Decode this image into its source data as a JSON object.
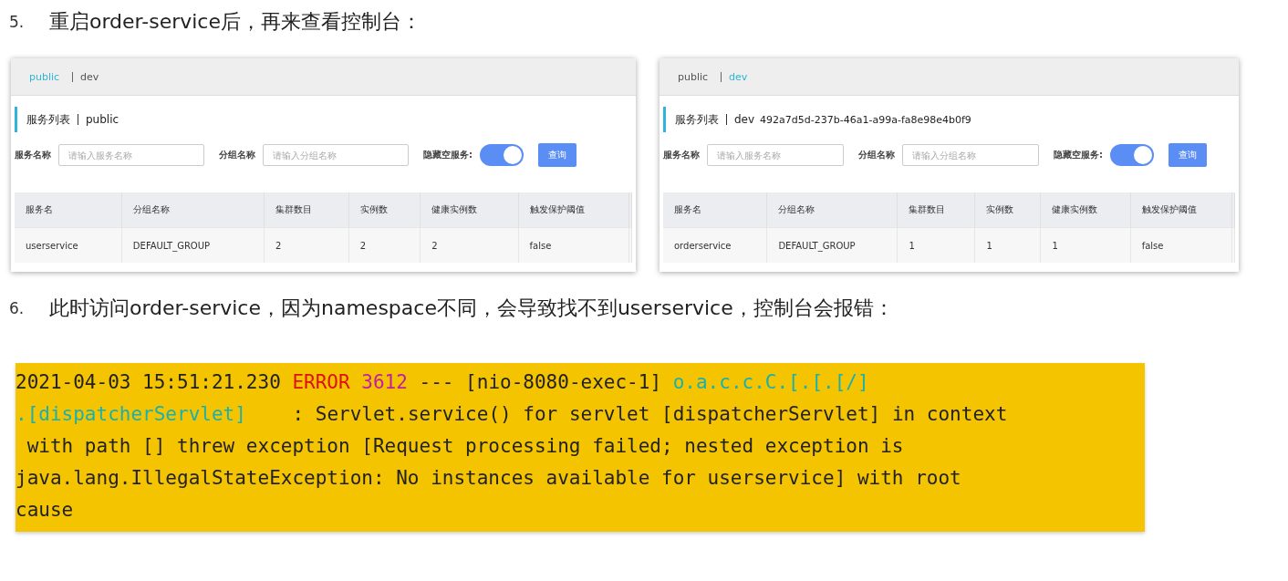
{
  "steps": [
    {
      "number": "5.",
      "text": "重启order-service后，再来查看控制台："
    },
    {
      "number": "6.",
      "text": "此时访问order-service，因为namespace不同，会导致找不到userservice，控制台会报错："
    }
  ],
  "consoles": [
    {
      "tabs": [
        {
          "label": "public",
          "selected": true
        },
        {
          "label": "dev",
          "selected": false
        }
      ],
      "title": "服务列表",
      "namespace": "public",
      "service_label": "服务名称",
      "service_placeholder": "请输入服务名称",
      "group_label": "分组名称",
      "group_placeholder": "请输入分组名称",
      "hide_label": "隐藏空服务:",
      "hide_empty": {
        "on": true
      },
      "query_button": "查询",
      "columns": [
        "服务名",
        "分组名称",
        "集群数目",
        "实例数",
        "健康实例数",
        "触发保护阈值"
      ],
      "rows": [
        [
          "userservice",
          "DEFAULT_GROUP",
          "2",
          "2",
          "2",
          "false"
        ]
      ]
    },
    {
      "tabs": [
        {
          "label": "public",
          "selected": false
        },
        {
          "label": "dev",
          "selected": true
        }
      ],
      "title": "服务列表",
      "namespace": "dev",
      "namespace_id": "492a7d5d-237b-46a1-a99a-fa8e98e4b0f9",
      "service_label": "服务名称",
      "service_placeholder": "请输入服务名称",
      "group_label": "分组名称",
      "group_placeholder": "请输入分组名称",
      "hide_label": "隐藏空服务:",
      "hide_empty": {
        "on": true
      },
      "query_button": "查询",
      "columns": [
        "服务名",
        "分组名称",
        "集群数目",
        "实例数",
        "健康实例数",
        "触发保护阈值"
      ],
      "rows": [
        [
          "orderservice",
          "DEFAULT_GROUP",
          "1",
          "1",
          "1",
          "false"
        ]
      ]
    }
  ],
  "log": {
    "lines": [
      [
        {
          "kind": "plain",
          "text": "2021-04-03 15:51:21.230 "
        },
        {
          "kind": "level",
          "text": "ERROR"
        },
        {
          "kind": "pid",
          "text": "3612"
        },
        {
          "kind": "plain",
          "text": " --- [nio-8080-exec-1] "
        },
        {
          "kind": "logger",
          "text": "o.a.c.c.C.[.[.[/]"
        }
      ],
      [
        {
          "kind": "logger",
          "text": ".[dispatcherServlet]"
        },
        {
          "kind": "plain",
          "text": "    : Servlet.service() for servlet [dispatcherServlet] in context"
        }
      ],
      [
        {
          "kind": "plain",
          "text": " with path [] threw exception [Request processing failed; nested exception is"
        }
      ],
      [
        {
          "kind": "plain",
          "text": "java.lang.IllegalStateException: No instances available for userservice] with root"
        }
      ],
      [
        {
          "kind": "plain",
          "text": "cause"
        }
      ]
    ]
  }
}
